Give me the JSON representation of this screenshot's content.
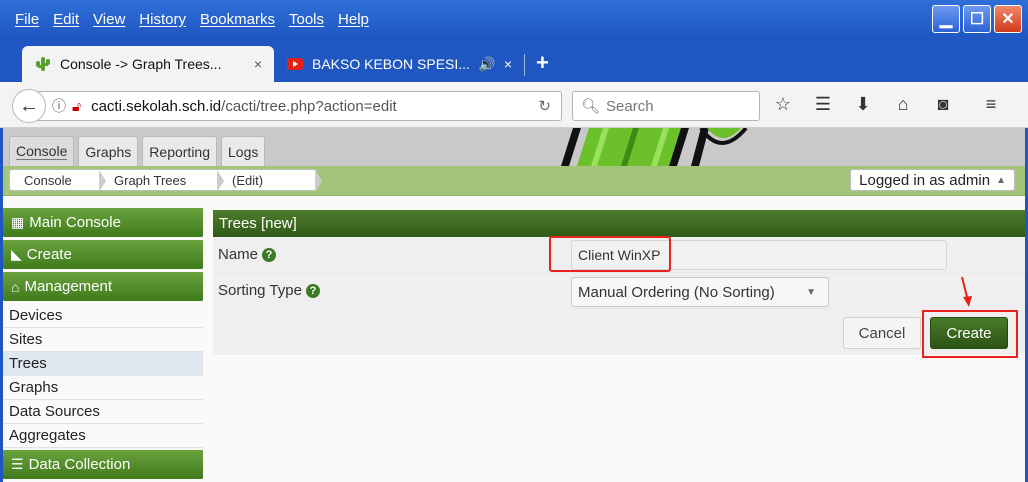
{
  "menu": [
    "File",
    "Edit",
    "View",
    "History",
    "Bookmarks",
    "Tools",
    "Help"
  ],
  "window_buttons": {
    "minimize": "▁",
    "maximize": "☐",
    "close": "✕"
  },
  "tabs": [
    {
      "label": "Console -> Graph Trees...",
      "close": "×"
    },
    {
      "label": "BAKSO KEBON SPESI...",
      "audio": "🔊",
      "close": "×"
    }
  ],
  "newtab": "+",
  "url": {
    "host": "cacti.sekolah.sch.id",
    "path": "/cacti/tree.php?action=edit"
  },
  "search": {
    "placeholder": "Search"
  },
  "cacti_tabs": [
    "Console",
    "Graphs",
    "Reporting",
    "Logs"
  ],
  "breadcrumb": [
    "Console",
    "Graph Trees",
    "(Edit)"
  ],
  "logged_in": "Logged in as admin",
  "sidebar": {
    "main_console": "Main Console",
    "create": "Create",
    "management": "Management",
    "items": [
      "Devices",
      "Sites",
      "Trees",
      "Graphs",
      "Data Sources",
      "Aggregates"
    ],
    "data_collection": "Data Collection"
  },
  "form": {
    "title": "Trees [new]",
    "name_label": "Name",
    "name_value": "Client WinXP",
    "sorting_label": "Sorting Type",
    "sorting_value": "Manual Ordering (No Sorting)",
    "help": "?",
    "cancel": "Cancel",
    "create": "Create"
  },
  "colors": {
    "accent_green": "#3f7a1c",
    "highlight_red": "#e8211d",
    "titlebar_blue": "#1f56c2"
  }
}
